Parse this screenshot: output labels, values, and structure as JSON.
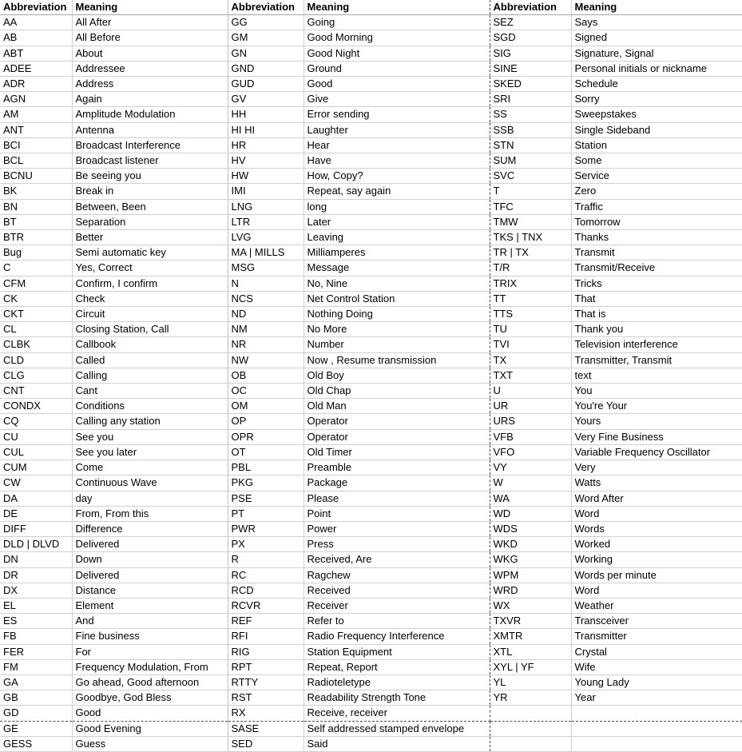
{
  "document": {
    "title": "Ham Radio CW Abbreviations Table",
    "type": "spreadsheet-table"
  },
  "table": {
    "headers": [
      "Abbreviation",
      "Meaning",
      "Abbreviation",
      "Meaning",
      "Abbreviation",
      "Meaning"
    ],
    "column_groups": [
      {
        "abbr_header": "Abbreviation",
        "meaning_header": "Meaning"
      },
      {
        "abbr_header": "Abbreviation",
        "meaning_header": "Meaning"
      },
      {
        "abbr_header": "Abbreviation",
        "meaning_header": "Meaning"
      }
    ],
    "dashed_break_after_row_index": 45,
    "rows": [
      {
        "a1": "AA",
        "m1": "All After",
        "a2": "GG",
        "m2": "Going",
        "a3": "SEZ",
        "m3": "Says"
      },
      {
        "a1": "AB",
        "m1": "All Before",
        "a2": "GM",
        "m2": "Good Morning",
        "a3": "SGD",
        "m3": "Signed"
      },
      {
        "a1": "ABT",
        "m1": "About",
        "a2": "GN",
        "m2": "Good Night",
        "a3": "SIG",
        "m3": "Signature, Signal"
      },
      {
        "a1": "ADEE",
        "m1": "Addressee",
        "a2": "GND",
        "m2": "Ground",
        "a3": "SINE",
        "m3": "Personal initials or nickname"
      },
      {
        "a1": "ADR",
        "m1": "Address",
        "a2": "GUD",
        "m2": "Good",
        "a3": "SKED",
        "m3": "Schedule"
      },
      {
        "a1": "AGN",
        "m1": "Again",
        "a2": "GV",
        "m2": "Give",
        "a3": "SRI",
        "m3": "Sorry"
      },
      {
        "a1": "AM",
        "m1": "Amplitude Modulation",
        "a2": "HH",
        "m2": "Error sending",
        "a3": "SS",
        "m3": "Sweepstakes"
      },
      {
        "a1": "ANT",
        "m1": "Antenna",
        "a2": "HI HI",
        "m2": "Laughter",
        "a3": "SSB",
        "m3": "Single Sideband"
      },
      {
        "a1": "BCI",
        "m1": "Broadcast Interference",
        "a2": "HR",
        "m2": "Hear",
        "a3": "STN",
        "m3": "Station"
      },
      {
        "a1": "BCL",
        "m1": "Broadcast listener",
        "a2": "HV",
        "m2": "Have",
        "a3": "SUM",
        "m3": "Some"
      },
      {
        "a1": "BCNU",
        "m1": "Be seeing you",
        "a2": "HW",
        "m2": "How, Copy?",
        "a3": "SVC",
        "m3": "Service"
      },
      {
        "a1": "BK",
        "m1": "Break in",
        "a2": "IMI",
        "m2": "Repeat, say again",
        "a3": "T",
        "m3": "Zero"
      },
      {
        "a1": "BN",
        "m1": "Between, Been",
        "a2": "LNG",
        "m2": "long",
        "a3": "TFC",
        "m3": "Traffic"
      },
      {
        "a1": "BT",
        "m1": "Separation",
        "a2": "LTR",
        "m2": "Later",
        "a3": "TMW",
        "m3": "Tomorrow"
      },
      {
        "a1": "BTR",
        "m1": "Better",
        "a2": "LVG",
        "m2": "Leaving",
        "a3": "TKS | TNX",
        "m3": "Thanks"
      },
      {
        "a1": "Bug",
        "m1": "Semi automatic key",
        "a2": "MA | MILLS",
        "m2": "Milliamperes",
        "a3": "TR | TX",
        "m3": "Transmit"
      },
      {
        "a1": "C",
        "m1": "Yes, Correct",
        "a2": "MSG",
        "m2": "Message",
        "a3": "T/R",
        "m3": "Transmit/Receive"
      },
      {
        "a1": "CFM",
        "m1": "Confirm, I confirm",
        "a2": "N",
        "m2": "No, Nine",
        "a3": "TRIX",
        "m3": "Tricks"
      },
      {
        "a1": "CK",
        "m1": "Check",
        "a2": "NCS",
        "m2": "Net Control Station",
        "a3": "TT",
        "m3": "That"
      },
      {
        "a1": "CKT",
        "m1": "Circuit",
        "a2": "ND",
        "m2": "Nothing Doing",
        "a3": "TTS",
        "m3": "That is"
      },
      {
        "a1": "CL",
        "m1": "Closing Station, Call",
        "a2": "NM",
        "m2": "No More",
        "a3": "TU",
        "m3": "Thank you"
      },
      {
        "a1": "CLBK",
        "m1": "Callbook",
        "a2": "NR",
        "m2": "Number",
        "a3": "TVI",
        "m3": "Television interference"
      },
      {
        "a1": "CLD",
        "m1": "Called",
        "a2": "NW",
        "m2": "Now , Resume transmission",
        "a3": "TX",
        "m3": "Transmitter, Transmit"
      },
      {
        "a1": "CLG",
        "m1": "Calling",
        "a2": "OB",
        "m2": "Old Boy",
        "a3": "TXT",
        "m3": "text"
      },
      {
        "a1": "CNT",
        "m1": "Cant",
        "a2": "OC",
        "m2": "Old Chap",
        "a3": "U",
        "m3": "You"
      },
      {
        "a1": "CONDX",
        "m1": "Conditions",
        "a2": "OM",
        "m2": "Old Man",
        "a3": "UR",
        "m3": "You're Your"
      },
      {
        "a1": "CQ",
        "m1": "Calling any station",
        "a2": "OP",
        "m2": "Operator",
        "a3": "URS",
        "m3": "Yours"
      },
      {
        "a1": "CU",
        "m1": "See you",
        "a2": "OPR",
        "m2": "Operator",
        "a3": "VFB",
        "m3": "Very Fine Business"
      },
      {
        "a1": "CUL",
        "m1": "See you later",
        "a2": "OT",
        "m2": "Old Timer",
        "a3": "VFO",
        "m3": "Variable Frequency Oscillator"
      },
      {
        "a1": "CUM",
        "m1": "Come",
        "a2": "PBL",
        "m2": "Preamble",
        "a3": "VY",
        "m3": "Very"
      },
      {
        "a1": "CW",
        "m1": "Continuous Wave",
        "a2": "PKG",
        "m2": "Package",
        "a3": "W",
        "m3": "Watts"
      },
      {
        "a1": "DA",
        "m1": "day",
        "a2": "PSE",
        "m2": "Please",
        "a3": "WA",
        "m3": "Word After"
      },
      {
        "a1": "DE",
        "m1": "From, From this",
        "a2": "PT",
        "m2": "Point",
        "a3": "WD",
        "m3": "Word"
      },
      {
        "a1": "DIFF",
        "m1": "Difference",
        "a2": "PWR",
        "m2": "Power",
        "a3": "WDS",
        "m3": "Words"
      },
      {
        "a1": "DLD | DLVD",
        "m1": "Delivered",
        "a2": "PX",
        "m2": "Press",
        "a3": "WKD",
        "m3": "Worked"
      },
      {
        "a1": "DN",
        "m1": "Down",
        "a2": "R",
        "m2": "Received, Are",
        "a3": "WKG",
        "m3": "Working"
      },
      {
        "a1": "DR",
        "m1": "Delivered",
        "a2": "RC",
        "m2": "Ragchew",
        "a3": "WPM",
        "m3": "Words per minute"
      },
      {
        "a1": "DX",
        "m1": "Distance",
        "a2": "RCD",
        "m2": "Received",
        "a3": "WRD",
        "m3": "Word"
      },
      {
        "a1": "EL",
        "m1": "Element",
        "a2": "RCVR",
        "m2": "Receiver",
        "a3": "WX",
        "m3": "Weather"
      },
      {
        "a1": "ES",
        "m1": "And",
        "a2": "REF",
        "m2": "Refer to",
        "a3": "TXVR",
        "m3": "Transceiver"
      },
      {
        "a1": "FB",
        "m1": "Fine business",
        "a2": "RFI",
        "m2": "Radio Frequency Interference",
        "a3": "XMTR",
        "m3": "Transmitter"
      },
      {
        "a1": "FER",
        "m1": "For",
        "a2": "RIG",
        "m2": "Station Equipment",
        "a3": "XTL",
        "m3": "Crystal"
      },
      {
        "a1": "FM",
        "m1": "Frequency Modulation, From",
        "a2": "RPT",
        "m2": "Repeat, Report",
        "a3": "XYL | YF",
        "m3": "Wife"
      },
      {
        "a1": "GA",
        "m1": "Go ahead, Good afternoon",
        "a2": "RTTY",
        "m2": "Radioteletype",
        "a3": "YL",
        "m3": "Young Lady"
      },
      {
        "a1": "GB",
        "m1": "Goodbye, God Bless",
        "a2": "RST",
        "m2": "Readability Strength Tone",
        "a3": "YR",
        "m3": "Year"
      },
      {
        "a1": "GD",
        "m1": "Good",
        "a2": "RX",
        "m2": "Receive, receiver",
        "a3": "",
        "m3": ""
      },
      {
        "a1": "GE",
        "m1": "Good Evening",
        "a2": "SASE",
        "m2": "Self addressed stamped envelope",
        "a3": "",
        "m3": ""
      },
      {
        "a1": "GESS",
        "m1": "Guess",
        "a2": "SED",
        "m2": "Said",
        "a3": "",
        "m3": ""
      }
    ]
  },
  "colors": {
    "text": "#000000",
    "grid_line": "#d0d0d0",
    "dashed_line": "#4d4d4d",
    "background": "#ffffff"
  }
}
